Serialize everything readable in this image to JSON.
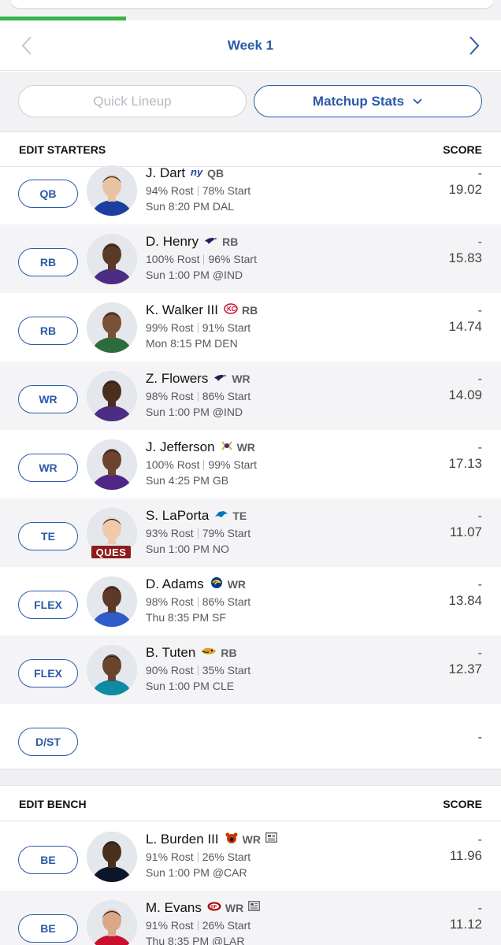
{
  "header": {
    "week_label": "Week 1"
  },
  "actions": {
    "quick_lineup": "Quick Lineup",
    "matchup_stats": "Matchup Stats"
  },
  "starters": {
    "title": "EDIT STARTERS",
    "score_label": "SCORE",
    "rows": [
      {
        "slot": "QB",
        "name": "J. Dart",
        "team_icon": "giants-logo-icon",
        "pos": "QB",
        "rost": "94% Rost",
        "start": "78% Start",
        "game": "Sun 8:20 PM DAL",
        "score": "-",
        "proj": "19.02"
      },
      {
        "slot": "RB",
        "name": "D. Henry",
        "team_icon": "ravens-logo-icon",
        "pos": "RB",
        "rost": "100% Rost",
        "start": "96% Start",
        "game": "Sun 1:00 PM @IND",
        "score": "-",
        "proj": "15.83"
      },
      {
        "slot": "RB",
        "name": "K. Walker III",
        "team_icon": "chiefs-logo-icon",
        "pos": "RB",
        "rost": "99% Rost",
        "start": "91% Start",
        "game": "Mon 8:15 PM DEN",
        "score": "-",
        "proj": "14.74"
      },
      {
        "slot": "WR",
        "name": "Z. Flowers",
        "team_icon": "ravens-logo-icon",
        "pos": "WR",
        "rost": "98% Rost",
        "start": "86% Start",
        "game": "Sun 1:00 PM @IND",
        "score": "-",
        "proj": "14.09"
      },
      {
        "slot": "WR",
        "name": "J. Jefferson",
        "team_icon": "vikings-logo-icon",
        "pos": "WR",
        "rost": "100% Rost",
        "start": "99% Start",
        "game": "Sun 4:25 PM GB",
        "score": "-",
        "proj": "17.13"
      },
      {
        "slot": "TE",
        "name": "S. LaPorta",
        "team_icon": "lions-logo-icon",
        "pos": "TE",
        "rost": "93% Rost",
        "start": "79% Start",
        "game": "Sun 1:00 PM NO",
        "score": "-",
        "proj": "11.07",
        "status": "QUES"
      },
      {
        "slot": "FLEX",
        "name": "D. Adams",
        "team_icon": "rams-logo-icon",
        "pos": "WR",
        "rost": "98% Rost",
        "start": "86% Start",
        "game": "Thu 8:35 PM SF",
        "score": "-",
        "proj": "13.84"
      },
      {
        "slot": "FLEX",
        "name": "B. Tuten",
        "team_icon": "jaguars-logo-icon",
        "pos": "RB",
        "rost": "90% Rost",
        "start": "35% Start",
        "game": "Sun 1:00 PM CLE",
        "score": "-",
        "proj": "12.37"
      },
      {
        "slot": "D/ST",
        "score": "-"
      }
    ]
  },
  "bench": {
    "title": "EDIT BENCH",
    "score_label": "SCORE",
    "rows": [
      {
        "slot": "BE",
        "name": "L. Burden III",
        "team_icon": "bears-logo-icon",
        "pos": "WR",
        "rost": "91% Rost",
        "start": "26% Start",
        "game": "Sun 1:00 PM @CAR",
        "score": "-",
        "proj": "11.96"
      },
      {
        "slot": "BE",
        "name": "M. Evans",
        "team_icon": "49ers-logo-icon",
        "pos": "WR",
        "rost": "91% Rost",
        "start": "26% Start",
        "game": "Thu 8:35 PM @LAR",
        "score": "-",
        "proj": "11.12"
      }
    ]
  },
  "colors": {
    "accent": "#2a5aa8",
    "progress": "#39b54a",
    "ques_badge": "#8e1c1c"
  }
}
